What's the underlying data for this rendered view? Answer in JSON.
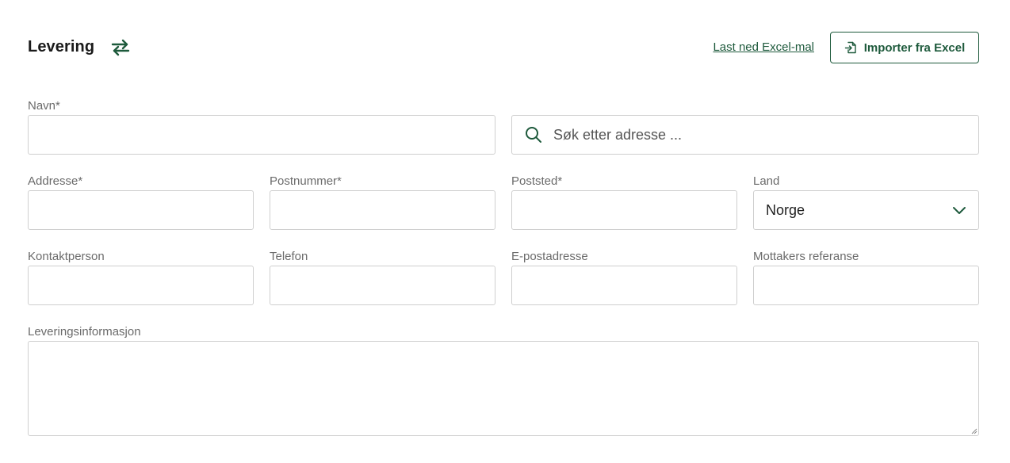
{
  "header": {
    "title": "Levering",
    "swap_icon": "swap-arrows-icon",
    "excel_template_link": "Last ned Excel-mal",
    "import_button": "Importer fra Excel",
    "import_icon": "file-import-icon"
  },
  "form": {
    "name": {
      "label": "Navn*",
      "value": ""
    },
    "address_search": {
      "placeholder": "Søk etter adresse ...",
      "icon": "search-icon"
    },
    "address": {
      "label": "Addresse*",
      "value": ""
    },
    "postal_code": {
      "label": "Postnummer*",
      "value": ""
    },
    "city": {
      "label": "Poststed*",
      "value": ""
    },
    "country": {
      "label": "Land",
      "value": "Norge",
      "icon": "chevron-down-icon"
    },
    "contact_person": {
      "label": "Kontaktperson",
      "value": ""
    },
    "phone": {
      "label": "Telefon",
      "value": ""
    },
    "email": {
      "label": "E-postadresse",
      "value": ""
    },
    "recipient_reference": {
      "label": "Mottakers referanse",
      "value": ""
    },
    "delivery_info": {
      "label": "Leveringsinformasjon",
      "value": ""
    }
  },
  "colors": {
    "accent": "#1e5a3c",
    "border": "#cfcfcf",
    "label": "#6b6b6b"
  }
}
